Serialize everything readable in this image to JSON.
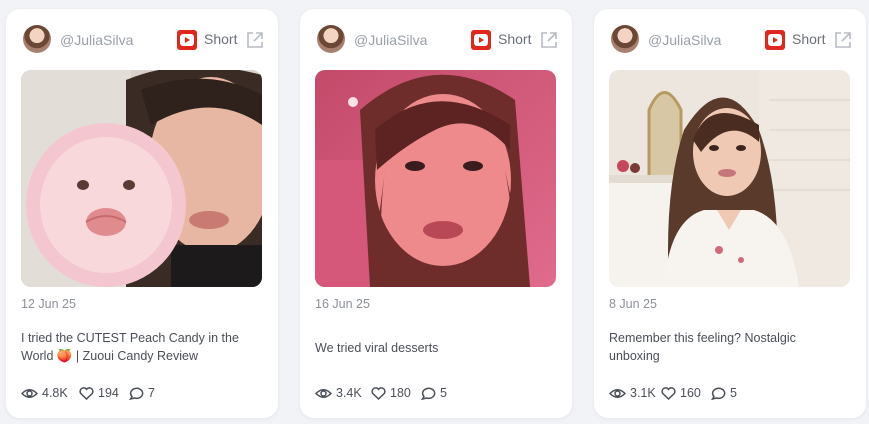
{
  "cards": [
    {
      "handle": "@JuliaSilva",
      "type_label": "Short",
      "date": "12 Jun 25",
      "title": "I tried the CUTEST Peach Candy in the World 🍑 | Zuoui Candy Review",
      "views": "4.8K",
      "likes": "194",
      "comments": "7"
    },
    {
      "handle": "@JuliaSilva",
      "type_label": "Short",
      "date": "16 Jun 25",
      "title": "We tried viral desserts",
      "views": "3.4K",
      "likes": "180",
      "comments": "5"
    },
    {
      "handle": "@JuliaSilva",
      "type_label": "Short",
      "date": "8 Jun 25",
      "title": "Remember this feeling? Nostalgic unboxing",
      "views": "3.1K",
      "likes": "160",
      "comments": "5"
    }
  ],
  "colors": {
    "platform_red": "#e1261c",
    "muted_text": "#9aa0a8",
    "body_text": "#4a4f57"
  },
  "icons": [
    "avatar",
    "youtube-icon",
    "external-link-icon",
    "eye-icon",
    "heart-icon",
    "comment-icon"
  ]
}
